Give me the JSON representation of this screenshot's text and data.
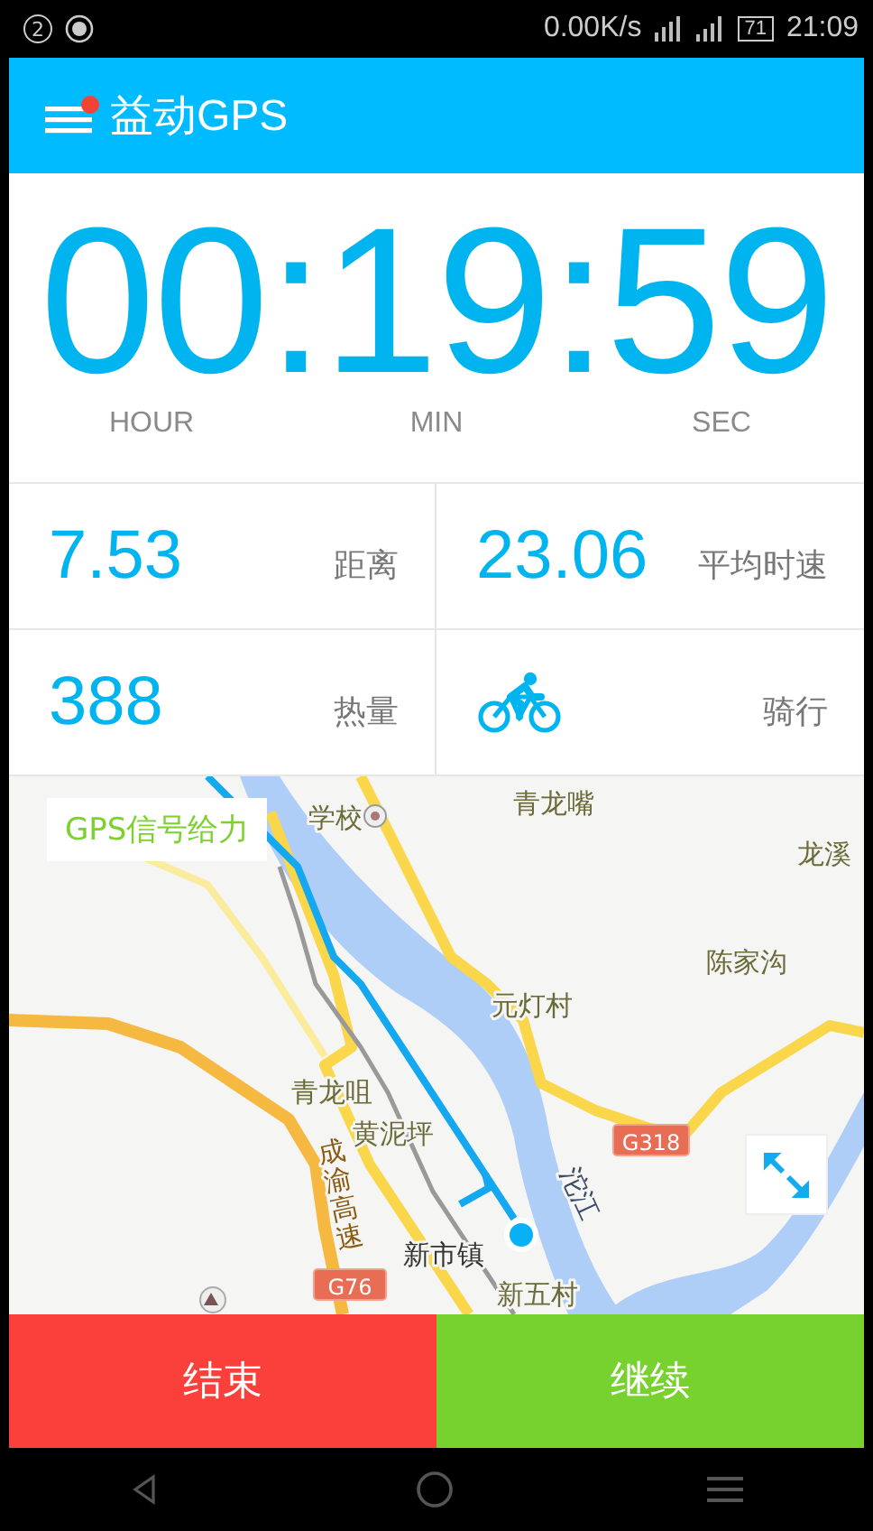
{
  "status_bar": {
    "notification_count": "2",
    "net_speed": "0.00K/s",
    "battery": "71",
    "time": "21:09"
  },
  "app_bar": {
    "title": "益动GPS",
    "menu_badge": true
  },
  "timer": {
    "value": "00:19:59",
    "units": [
      "HOUR",
      "MIN",
      "SEC"
    ]
  },
  "stats": [
    {
      "kind": "number",
      "value": "7.53",
      "label": "距离"
    },
    {
      "kind": "number",
      "value": "23.06",
      "label": "平均时速"
    },
    {
      "kind": "number",
      "value": "388",
      "label": "热量"
    },
    {
      "kind": "sport",
      "label": "骑行"
    }
  ],
  "map": {
    "signal_label": "GPS信号给力",
    "places": [
      "学校",
      "青龙嘴",
      "龙溪",
      "陈家沟",
      "元灯村",
      "青龙咀",
      "黄泥坪",
      "成渝高速",
      "沱江",
      "新市镇",
      "新五村"
    ],
    "road_shields": [
      "G318",
      "G76"
    ]
  },
  "buttons": [
    {
      "label": "结束",
      "kind": "stop"
    },
    {
      "label": "继续",
      "kind": "resume"
    }
  ]
}
